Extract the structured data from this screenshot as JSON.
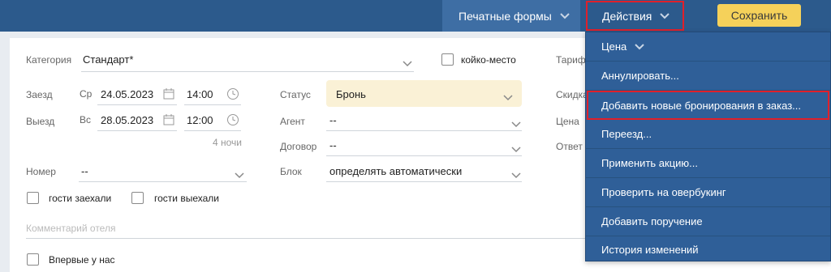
{
  "toolbar": {
    "print_label": "Печатные формы",
    "actions_label": "Действия",
    "save_label": "Сохранить"
  },
  "form": {
    "category_label": "Категория",
    "category_value": "Стандарт*",
    "bed_label": "койко-место",
    "tariff_label": "Тариф",
    "checkin_label": "Заезд",
    "checkin_day": "Ср",
    "checkin_date": "24.05.2023",
    "checkin_time": "14:00",
    "checkout_label": "Выезд",
    "checkout_day": "Вс",
    "checkout_date": "28.05.2023",
    "checkout_time": "12:00",
    "nights": "4 ночи",
    "status_label": "Статус",
    "status_value": "Бронь",
    "agent_label": "Агент",
    "agent_value": "--",
    "contract_label": "Договор",
    "contract_value": "--",
    "block_label": "Блок",
    "block_value": "определять автоматически",
    "room_label": "Номер",
    "room_value": "--",
    "discount_label": "Скидка",
    "price_label": "Цена",
    "responsible_label": "Ответ",
    "guests_in_label": "гости заехали",
    "guests_out_label": "гости выехали",
    "hotel_comment_placeholder": "Комментарий отеля",
    "first_time_label": "Впервые у нас"
  },
  "menu": {
    "items": [
      {
        "label": "Цена"
      },
      {
        "label": "Аннулировать..."
      },
      {
        "label": "Добавить новые бронирования в заказ..."
      },
      {
        "label": "Переезд..."
      },
      {
        "label": "Применить акцию..."
      },
      {
        "label": "Проверить на овербукинг"
      },
      {
        "label": "Добавить поручение"
      },
      {
        "label": "История изменений"
      }
    ]
  },
  "colors": {
    "topbar": "#2c5a8c",
    "menu_bg": "#2f5f98",
    "save_button": "#f5d15a",
    "highlight": "#e0202a",
    "status_bg": "#faf1d6"
  }
}
